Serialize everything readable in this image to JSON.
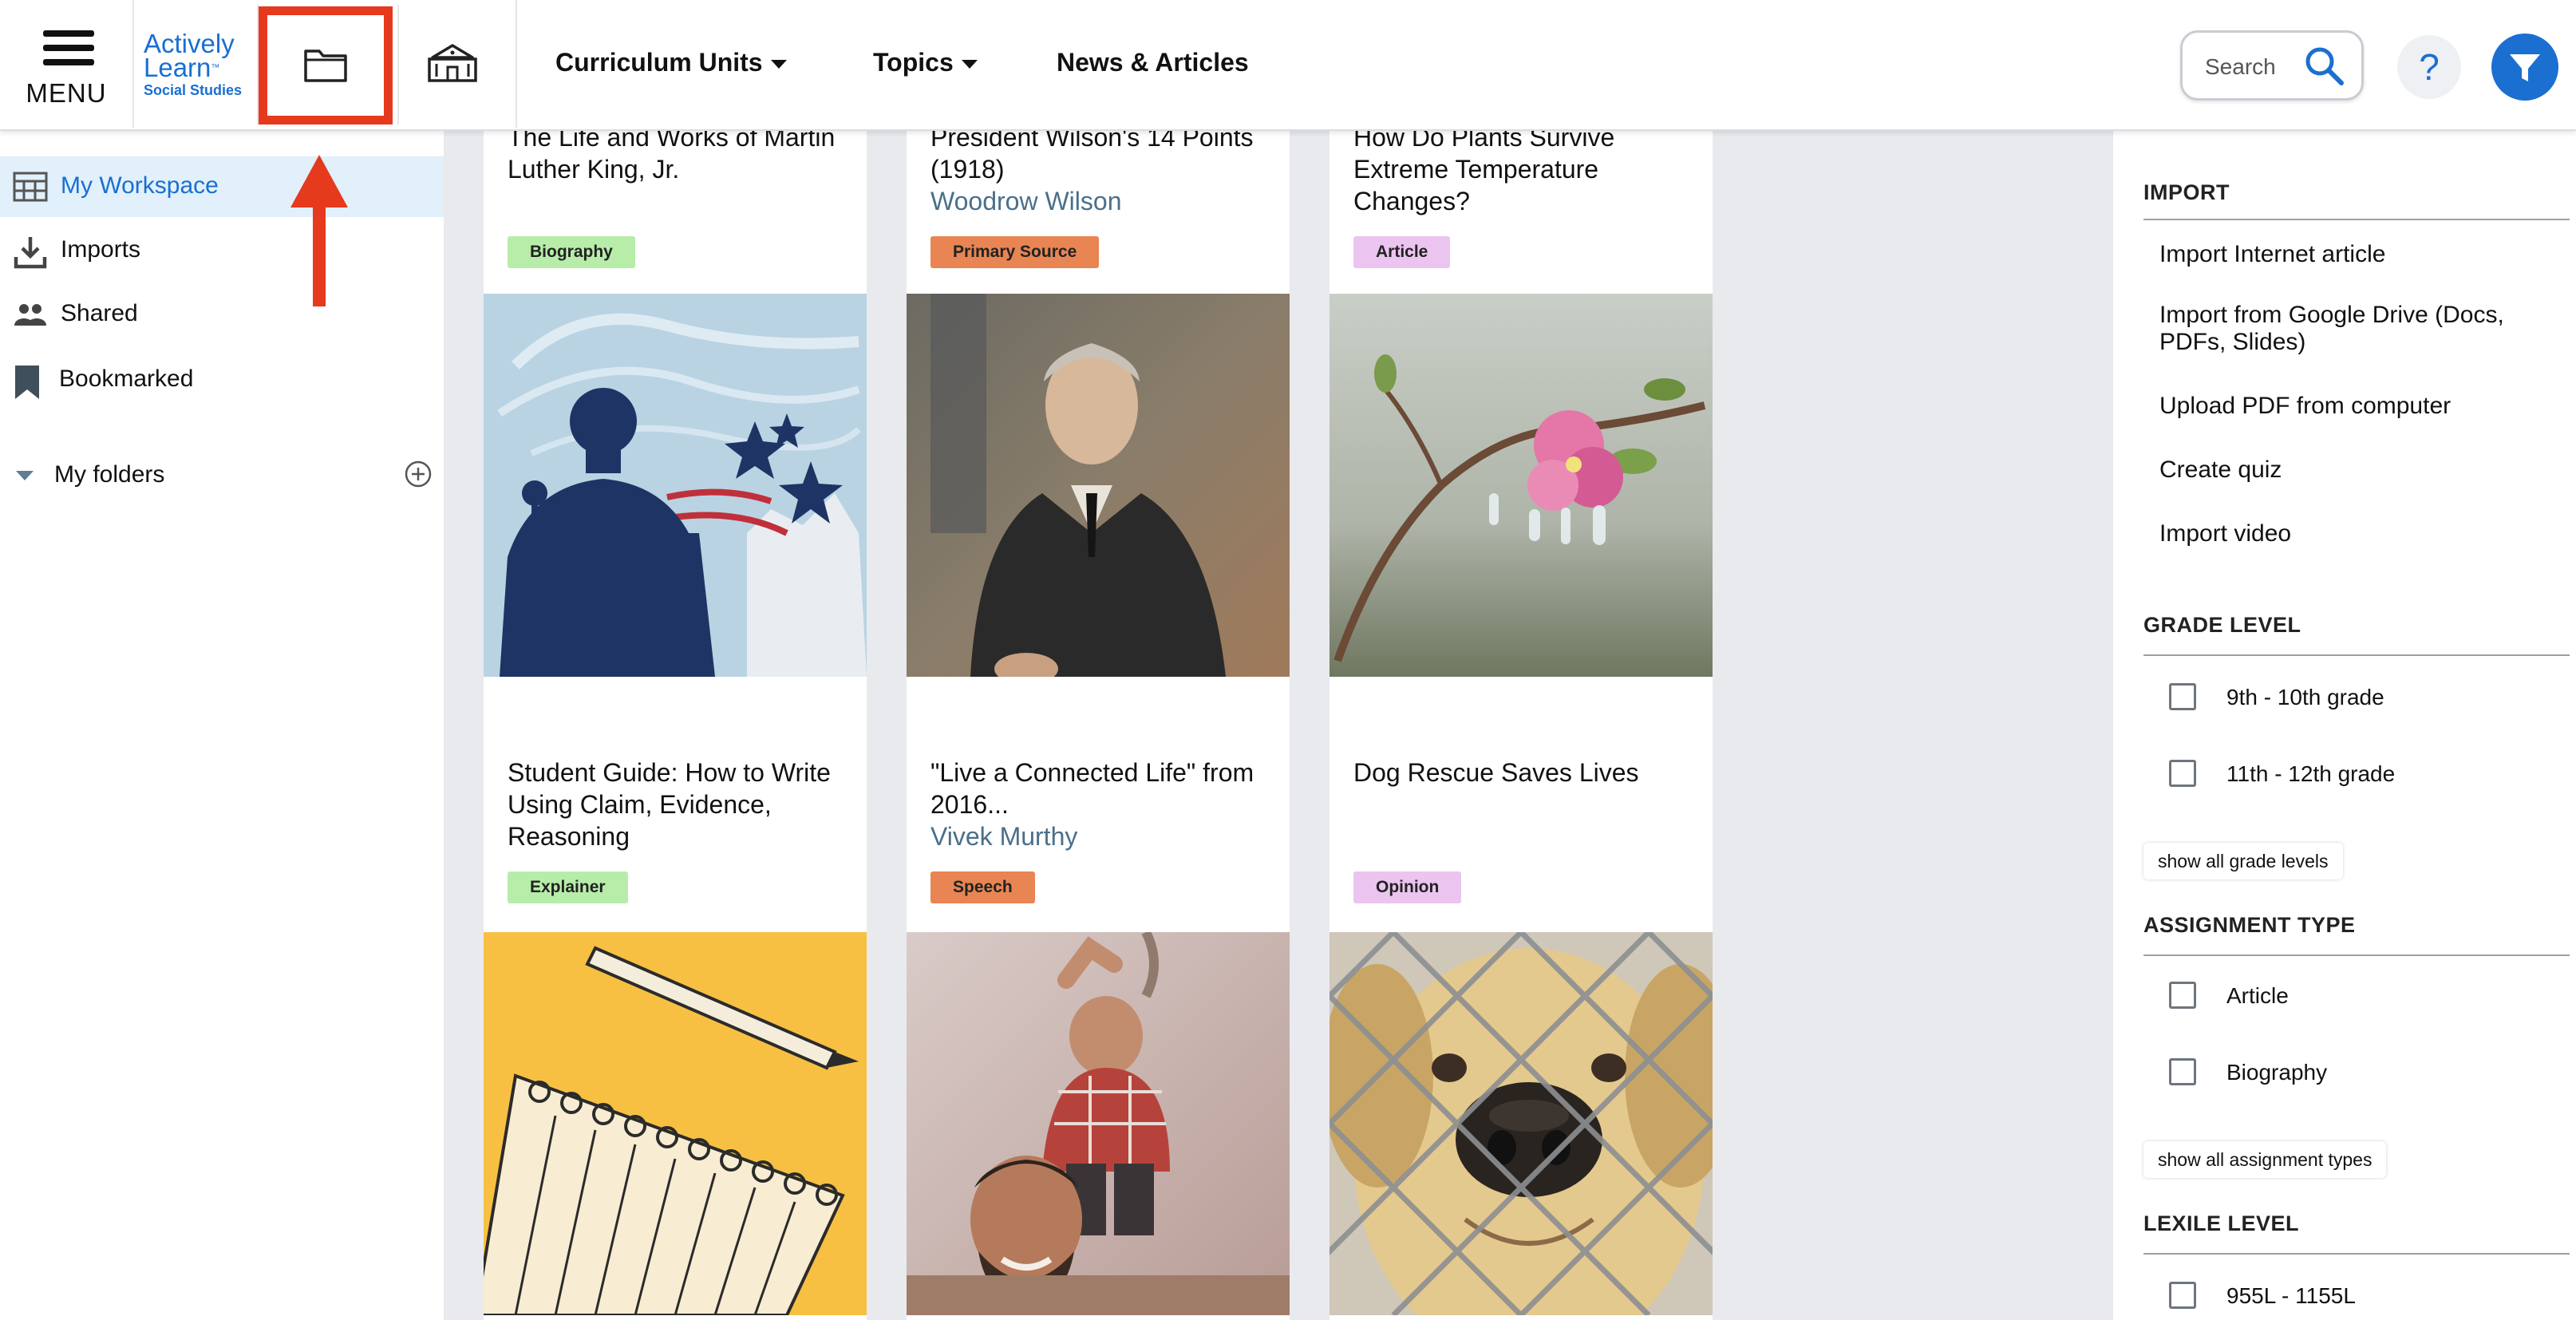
{
  "header": {
    "menu_label": "MENU",
    "logo": {
      "name_line1": "Actively",
      "name_line2": "Learn",
      "tm": "™",
      "subtitle": "Social Studies"
    },
    "nav": [
      {
        "label": "Curriculum Units",
        "has_dropdown": true
      },
      {
        "label": "Topics",
        "has_dropdown": true
      },
      {
        "label": "News & Articles",
        "has_dropdown": false
      }
    ],
    "search": {
      "placeholder": "Search"
    },
    "help_label": "?",
    "accent_color": "#1a6fd1",
    "highlight_color": "#e53a1d"
  },
  "sidebar": {
    "items": [
      {
        "label": "My Workspace",
        "icon": "workspace-icon",
        "active": true
      },
      {
        "label": "Imports",
        "icon": "download-icon"
      },
      {
        "label": "Shared",
        "icon": "people-icon"
      },
      {
        "label": "Bookmarked",
        "icon": "bookmark-icon"
      }
    ],
    "folders_label": "My folders"
  },
  "cards": [
    {
      "title": "The Life and Works of Martin Luther King, Jr.",
      "author": "",
      "badge": "Biography",
      "badge_color": "green"
    },
    {
      "title": "President Wilson's 14 Points (1918)",
      "author": "Woodrow Wilson",
      "badge": "Primary Source",
      "badge_color": "orange"
    },
    {
      "title": "How Do Plants Survive Extreme Temperature Changes?",
      "author": "",
      "badge": "Article",
      "badge_color": "purple"
    },
    {
      "title": "Student Guide: How to Write Using Claim, Evidence, Reasoning",
      "author": "",
      "badge": "Explainer",
      "badge_color": "green"
    },
    {
      "title": "\"Live a Connected Life\" from 2016...",
      "author": "Vivek Murthy",
      "badge": "Speech",
      "badge_color": "orange"
    },
    {
      "title": "Dog Rescue Saves Lives",
      "author": "",
      "badge": "Opinion",
      "badge_color": "purple"
    }
  ],
  "filters": {
    "import": {
      "heading": "IMPORT",
      "links": [
        "Import Internet article",
        "Import from Google Drive (Docs, PDFs, Slides)",
        "Upload PDF from computer",
        "Create quiz",
        "Import video"
      ]
    },
    "grade_level": {
      "heading": "GRADE LEVEL",
      "options": [
        "9th - 10th grade",
        "11th - 12th grade"
      ],
      "show_all": "show all grade levels"
    },
    "assignment_type": {
      "heading": "ASSIGNMENT TYPE",
      "options": [
        "Article",
        "Biography"
      ],
      "show_all": "show all assignment types"
    },
    "lexile_level": {
      "heading": "LEXILE LEVEL",
      "options": [
        "955L - 1155L"
      ]
    }
  }
}
